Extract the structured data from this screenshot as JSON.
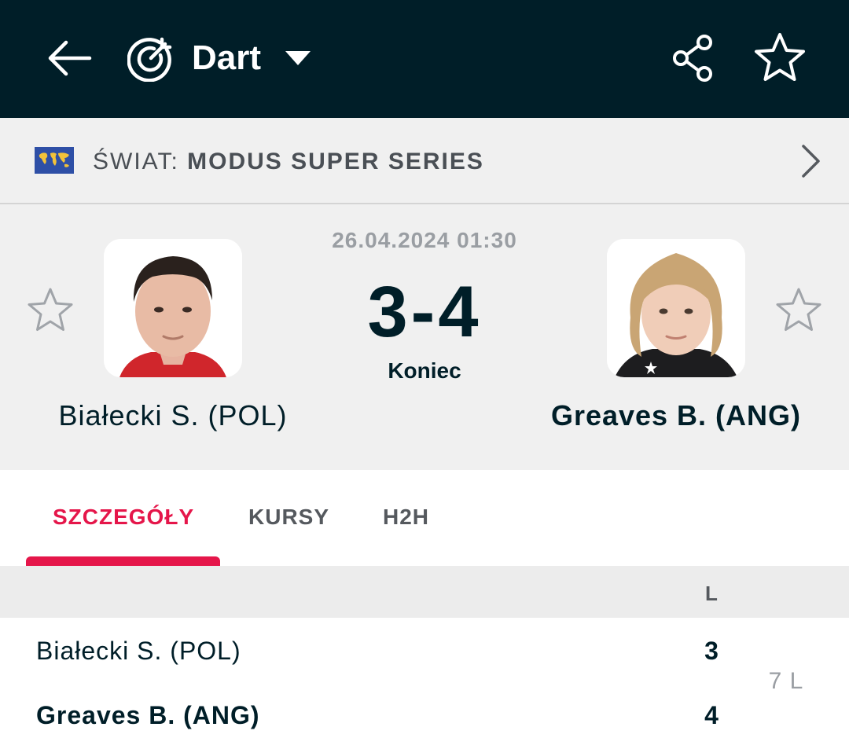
{
  "header": {
    "back_icon": "arrow-left-icon",
    "sport_icon": "dart-target-icon",
    "sport_name": "Dart",
    "dropdown_icon": "caret-down-icon",
    "share_icon": "share-icon",
    "favorite_icon": "star-outline-icon",
    "background": "#001e28"
  },
  "tournament": {
    "flag_icon": "world-flag-icon",
    "country": "ŚWIAT:",
    "name": "MODUS SUPER SERIES",
    "chevron_icon": "chevron-right-icon"
  },
  "match": {
    "datetime": "26.04.2024 01:30",
    "score": "3-4",
    "status": "Koniec",
    "home": {
      "name": "Białecki S. (POL)",
      "photo": "player-photo",
      "star_icon": "star-outline-icon"
    },
    "away": {
      "name": "Greaves B. (ANG)",
      "photo": "player-photo",
      "star_icon": "star-outline-icon"
    }
  },
  "tabs": [
    {
      "label": "SZCZEGÓŁY",
      "active": true
    },
    {
      "label": "KURSY",
      "active": false
    },
    {
      "label": "H2H",
      "active": false
    }
  ],
  "score_table": {
    "column": "L",
    "rows": [
      {
        "player": "Białecki S. (POL)",
        "legs": "3"
      },
      {
        "player": "Greaves B. (ANG)",
        "legs": "4"
      }
    ],
    "total": "7 L"
  },
  "colors": {
    "accent": "#e5164a",
    "text_dark": "#001e28",
    "muted": "#9a9ea3",
    "panel": "#f0f0f0"
  }
}
